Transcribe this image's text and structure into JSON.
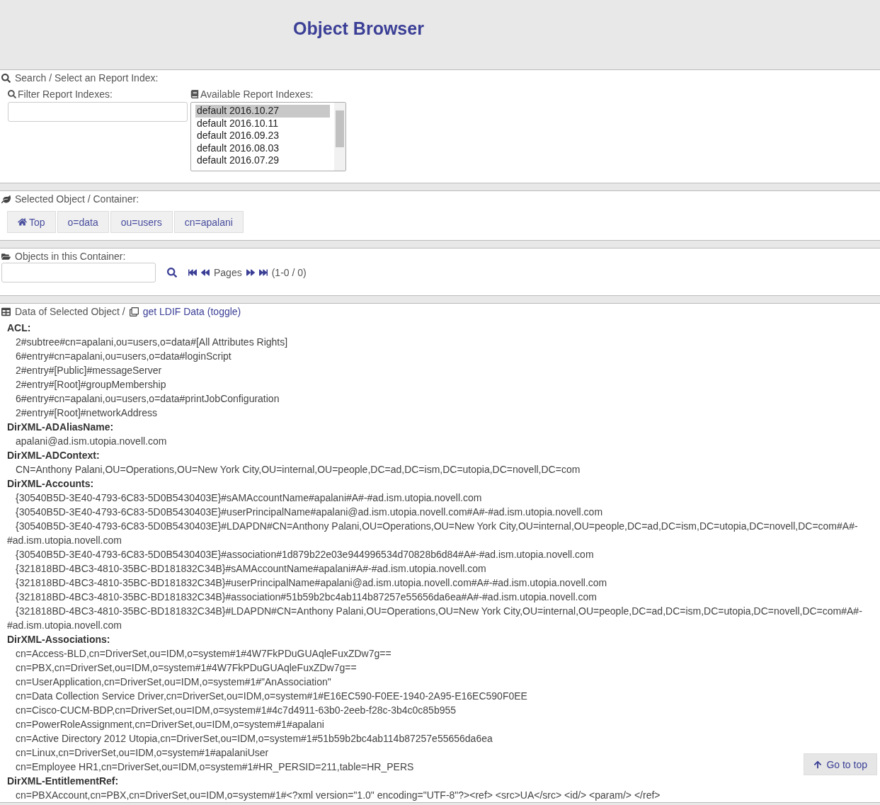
{
  "title": "Object Browser",
  "search_panel": {
    "heading": "Search / Select an Report Index:",
    "filter_label": "Filter Report Indexes:",
    "available_label": "Available Report Indexes:",
    "indexes": [
      {
        "label": "default 2016.10.27",
        "selected": true
      },
      {
        "label": "default 2016.10.11",
        "selected": false
      },
      {
        "label": "default 2016.09.23",
        "selected": false
      },
      {
        "label": "default 2016.08.03",
        "selected": false
      },
      {
        "label": "default 2016.07.29",
        "selected": false
      }
    ]
  },
  "selected_panel": {
    "heading": "Selected Object / Container:",
    "breadcrumbs": [
      {
        "label": "Top",
        "kind": "home"
      },
      {
        "label": "o=data",
        "kind": "plain"
      },
      {
        "label": "ou=users",
        "kind": "plain"
      },
      {
        "label": "cn=apalani",
        "kind": "plain"
      }
    ]
  },
  "objects_panel": {
    "heading": "Objects in this Container:",
    "pages_label": "Pages",
    "range": "(1-0 / 0)"
  },
  "data_panel": {
    "heading": "Data of Selected Object /",
    "ldif_link": "get LDIF Data",
    "toggle_link": "(toggle)",
    "attributes": [
      {
        "name": "ACL:",
        "values": [
          "2#subtree#cn=apalani,ou=users,o=data#[All Attributes Rights]",
          "6#entry#cn=apalani,ou=users,o=data#loginScript",
          "2#entry#[Public]#messageServer",
          "2#entry#[Root]#groupMembership",
          "6#entry#cn=apalani,ou=users,o=data#printJobConfiguration",
          "2#entry#[Root]#networkAddress"
        ]
      },
      {
        "name": "DirXML-ADAliasName:",
        "values": [
          "apalani@ad.ism.utopia.novell.com"
        ]
      },
      {
        "name": "DirXML-ADContext:",
        "values": [
          "CN=Anthony Palani,OU=Operations,OU=New York City,OU=internal,OU=people,DC=ad,DC=ism,DC=utopia,DC=novell,DC=com"
        ]
      },
      {
        "name": "DirXML-Accounts:",
        "values": [
          "{30540B5D-3E40-4793-6C83-5D0B5430403E}#sAMAccountName#apalani#A#-#ad.ism.utopia.novell.com",
          "{30540B5D-3E40-4793-6C83-5D0B5430403E}#userPrincipalName#apalani@ad.ism.utopia.novell.com#A#-#ad.ism.utopia.novell.com",
          "{30540B5D-3E40-4793-6C83-5D0B5430403E}#LDAPDN#CN=Anthony Palani,OU=Operations,OU=New York City,OU=internal,OU=people,DC=ad,DC=ism,DC=utopia,DC=novell,DC=com#A#-#ad.ism.utopia.novell.com",
          "{30540B5D-3E40-4793-6C83-5D0B5430403E}#association#1d879b22e03e944996534d70828b6d84#A#-#ad.ism.utopia.novell.com",
          "{321818BD-4BC3-4810-35BC-BD181832C34B}#sAMAccountName#apalani#A#-#ad.ism.utopia.novell.com",
          "{321818BD-4BC3-4810-35BC-BD181832C34B}#userPrincipalName#apalani@ad.ism.utopia.novell.com#A#-#ad.ism.utopia.novell.com",
          "{321818BD-4BC3-4810-35BC-BD181832C34B}#association#51b59b2bc4ab114b87257e55656da6ea#A#-#ad.ism.utopia.novell.com",
          "{321818BD-4BC3-4810-35BC-BD181832C34B}#LDAPDN#CN=Anthony Palani,OU=Operations,OU=New York City,OU=internal,OU=people,DC=ad,DC=ism,DC=utopia,DC=novell,DC=com#A#-#ad.ism.utopia.novell.com"
        ]
      },
      {
        "name": "DirXML-Associations:",
        "values": [
          "cn=Access-BLD,cn=DriverSet,ou=IDM,o=system#1#4W7FkPDuGUAqleFuxZDw7g==",
          "cn=PBX,cn=DriverSet,ou=IDM,o=system#1#4W7FkPDuGUAqleFuxZDw7g==",
          "cn=UserApplication,cn=DriverSet,ou=IDM,o=system#1#\"AnAssociation\"",
          "cn=Data Collection Service Driver,cn=DriverSet,ou=IDM,o=system#1#E16EC590-F0EE-1940-2A95-E16EC590F0EE",
          "cn=Cisco-CUCM-BDP,cn=DriverSet,ou=IDM,o=system#1#4c7d4911-63b0-2eeb-f28c-3b4c0c85b955",
          "cn=PowerRoleAssignment,cn=DriverSet,ou=IDM,o=system#1#apalani",
          "cn=Active Directory 2012 Utopia,cn=DriverSet,ou=IDM,o=system#1#51b59b2bc4ab114b87257e55656da6ea",
          "cn=Linux,cn=DriverSet,ou=IDM,o=system#1#apalaniUser",
          "cn=Employee HR1,cn=DriverSet,ou=IDM,o=system#1#HR_PERSID=211,table=HR_PERS"
        ]
      },
      {
        "name": "DirXML-EntitlementRef:",
        "values": [
          "cn=PBXAccount,cn=PBX,cn=DriverSet,ou=IDM,o=system#1#<?xml version=\"1.0\" encoding=\"UTF-8\"?><ref> <src>UA</src> <id/> <param/> </ref>"
        ]
      }
    ]
  },
  "go_to_top": "Go to top"
}
